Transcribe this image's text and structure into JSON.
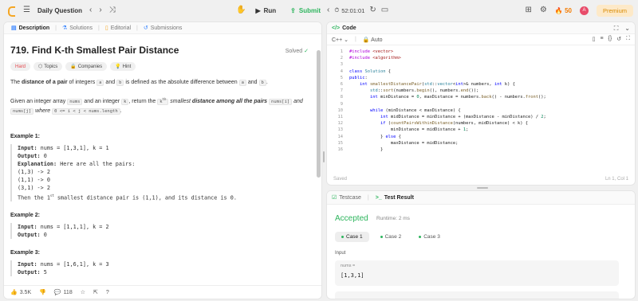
{
  "topbar": {
    "title": "Daily Question",
    "run": "Run",
    "submit": "Submit",
    "timer": "52:01:01",
    "streak": "50",
    "avatar": "A",
    "premium": "Premium"
  },
  "tabs": [
    "Description",
    "Solutions",
    "Editorial",
    "Submissions"
  ],
  "problem": {
    "title": "719. Find K-th Smallest Pair Distance",
    "status": "Solved",
    "chips": [
      "Hard",
      "Topics",
      "Companies",
      "Hint"
    ],
    "p1_a": "The ",
    "p1_b": "distance of a pair",
    "p1_c": " of integers ",
    "p1_code1": "a",
    "p1_d": " and ",
    "p1_code2": "b",
    "p1_e": " is defined as the absolute difference between ",
    "p1_code3": "a",
    "p1_f": " and ",
    "p1_code4": "b",
    "p1_g": ".",
    "p2_a": "Given an integer array ",
    "p2_code1": "nums",
    "p2_b": " and an integer ",
    "p2_code2": "k",
    "p2_c": ", return the ",
    "p2_d": "k",
    "p2_sup": "th",
    "p2_e": " smallest ",
    "p2_f": "distance among all the pairs",
    "p2_code3": "nums[i]",
    "p2_g": " and ",
    "p2_code4": "nums[j]",
    "p2_h": " where ",
    "p2_code5": "0 <= i < j < nums.length",
    "p2_i": "."
  },
  "examples": [
    {
      "title": "Example 1:",
      "input_label": "Input:",
      "input": " nums = [1,3,1], k = 1",
      "output_label": "Output:",
      "output": " 0",
      "expl_label": "Explanation:",
      "expl": " Here are all the pairs:",
      "lines": [
        "(1,3) -> 2",
        "(1,1) -> 0",
        "(3,1) -> 2"
      ],
      "final_a": "Then the 1",
      "final_sup": "st",
      "final_b": " smallest distance pair is (1,1), and its distance is 0."
    },
    {
      "title": "Example 2:",
      "input_label": "Input:",
      "input": " nums = [1,1,1], k = 2",
      "output_label": "Output:",
      "output": " 0"
    },
    {
      "title": "Example 3:",
      "input_label": "Input:",
      "input": " nums = [1,6,1], k = 3",
      "output_label": "Output:",
      "output": " 5"
    }
  ],
  "footer": {
    "likes": "3.5K",
    "comments": "118"
  },
  "code": {
    "header": "Code",
    "lang": "C++",
    "mode": "Auto",
    "saved": "Saved",
    "position": "Ln 1, Col 1",
    "lines": [
      "#include <vector>",
      "#include <algorithm>",
      "",
      "class Solution {",
      "public:",
      "    int smallestDistancePair(std::vector<int>& numbers, int k) {",
      "        std::sort(numbers.begin(), numbers.end());",
      "        int minDistance = 0, maxDistance = numbers.back() - numbers.front();",
      "",
      "        while (minDistance < maxDistance) {",
      "            int midDistance = minDistance + (maxDistance - minDistance) / 2;",
      "            if (countPairsWithinDistance(numbers, midDistance) < k) {",
      "                minDistance = midDistance + 1;",
      "            } else {",
      "                maxDistance = midDistance;",
      "            }"
    ]
  },
  "result": {
    "tab1": "Testcase",
    "tab2": "Test Result",
    "status": "Accepted",
    "runtime": "Runtime: 2 ms",
    "cases": [
      "Case 1",
      "Case 2",
      "Case 3"
    ],
    "input_label": "Input",
    "var_name": "nums =",
    "var_value": "[1,3,1]"
  }
}
